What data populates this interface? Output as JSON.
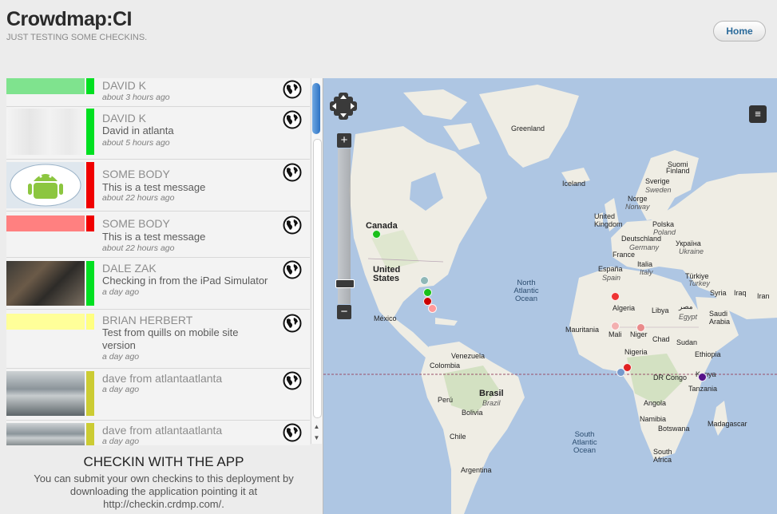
{
  "header": {
    "title": "Crowdmap:CI",
    "tagline": "JUST TESTING SOME CHECKINS.",
    "home_label": "Home"
  },
  "checkins": [
    {
      "name": "DAVID K",
      "message": "",
      "time": "about 3 hours ago",
      "stripe_color": "#00e021",
      "thumb": "color",
      "thumb_color": "#7fe38e"
    },
    {
      "name": "DAVID K",
      "message": "David in atlanta",
      "time": "about 5 hours ago",
      "stripe_color": "#00e021",
      "thumb": "blurred-photo"
    },
    {
      "name": "SOME BODY",
      "message": "This is a test message",
      "time": "about 22 hours ago",
      "stripe_color": "#f00000",
      "thumb": "android-photo"
    },
    {
      "name": "SOME BODY",
      "message": "This is a test message",
      "time": "about 22 hours ago",
      "stripe_color": "#f00000",
      "thumb": "color",
      "thumb_color": "#ff8080"
    },
    {
      "name": "DALE ZAK",
      "message": "Checking in from the iPad Simulator",
      "time": "a day ago",
      "stripe_color": "#00e021",
      "thumb": "soil-photo"
    },
    {
      "name": "BRIAN HERBERT",
      "message": "Test from quills on mobile site version",
      "time": "a day ago",
      "stripe_color": "#ffff80",
      "thumb": "color",
      "thumb_color": "#ffff99"
    },
    {
      "name": "dave from atlantaatlanta",
      "message": "",
      "time": "a day ago",
      "stripe_color": "#cccc33",
      "thumb": "room-photo"
    },
    {
      "name": "dave from atlantaatlanta",
      "message": "",
      "time": "a day ago",
      "stripe_color": "#cccc33",
      "thumb": "room-photo"
    }
  ],
  "cta": {
    "title": "CHECKIN WITH THE APP",
    "text": "You can submit your own checkins to this deployment by downloading the application pointing it at http://checkin.crdmp.com/."
  },
  "map": {
    "labels": {
      "greenland": "Greenland",
      "iceland": "Iceland",
      "canada": "Canada",
      "united_states": "United States",
      "mexico": "México",
      "suomi": "Suomi",
      "finland": "Finland",
      "sverige": "Sverige",
      "sweden": "Sweden",
      "norge": "Norge",
      "norway": "Norway",
      "uk": "United Kingdom",
      "polska": "Polska",
      "poland": "Poland",
      "deutschland": "Deutschland",
      "germany": "Germany",
      "ukraine_native": "Україна",
      "ukraine": "Ukraine",
      "france": "France",
      "espana": "España",
      "spain": "Spain",
      "italia": "Italia",
      "italy": "Italy",
      "turkiye": "Türkiye",
      "turkey": "Turkey",
      "syria": "Syria",
      "iraq": "Iraq",
      "iran": "Iran",
      "algeria": "Algeria",
      "libya": "Libya",
      "egypt_native": "مصر",
      "egypt": "Egypt",
      "saudi_arabia": "Saudi Arabia",
      "mauritania": "Mauritania",
      "mali": "Mali",
      "niger": "Niger",
      "chad": "Chad",
      "sudan": "Sudan",
      "ethiopia": "Ethiopia",
      "nigeria": "Nigeria",
      "dr_congo": "DR Congo",
      "kenya": "Kenya",
      "tanzania": "Tanzania",
      "angola": "Angola",
      "namibia": "Namibia",
      "botswana": "Botswana",
      "madagascar": "Madagascar",
      "south_africa": "South Africa",
      "venezuela": "Venezuela",
      "colombia": "Colombia",
      "brasil": "Brasil",
      "brazil": "Brazil",
      "peru": "Perú",
      "bolivia": "Bolivia",
      "chile": "Chile",
      "argentina": "Argentina",
      "north_atlantic": "North Atlantic Ocean",
      "south_atlantic": "South Atlantic Ocean"
    },
    "marker_colors": [
      "#8fb8b8",
      "#19c019",
      "#cc0000",
      "#ff9999",
      "#ee3333",
      "#f3b0b0",
      "#e98a8a",
      "#e02020",
      "#7799cc",
      "#551188"
    ]
  }
}
